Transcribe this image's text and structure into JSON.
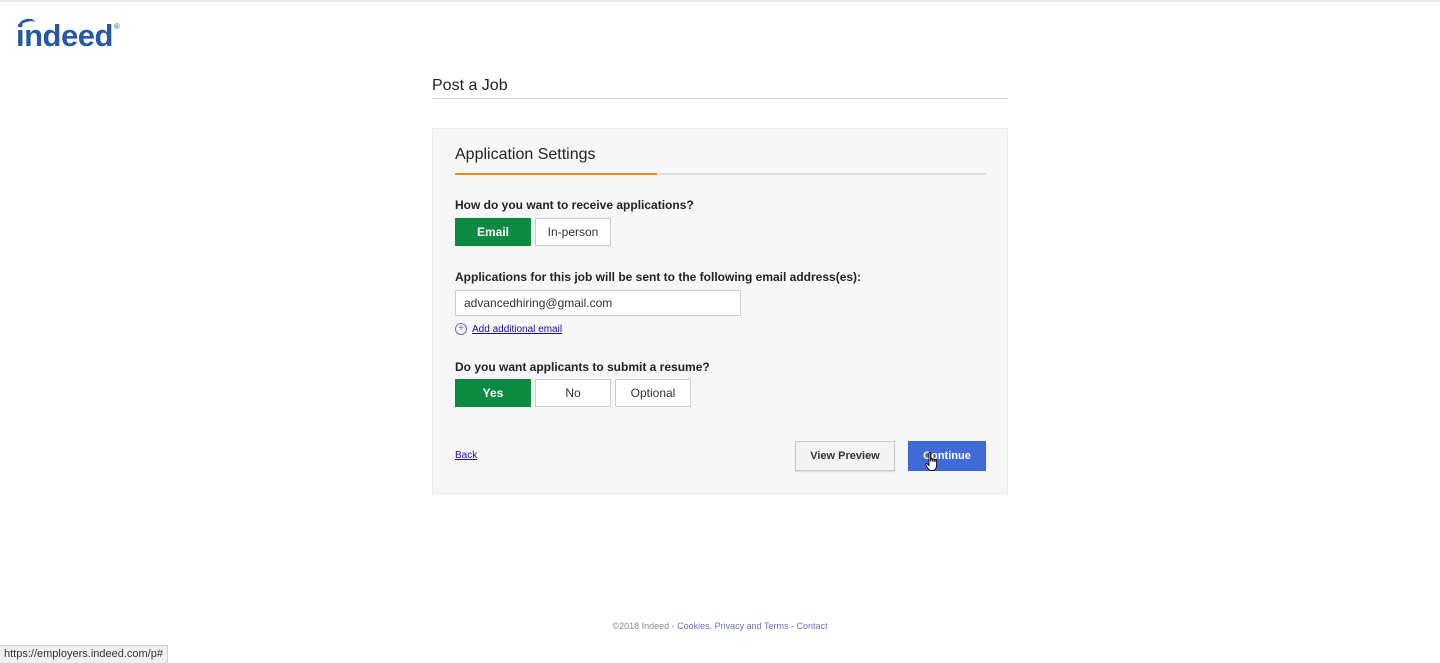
{
  "brand": {
    "logo_text": "indeed",
    "registered_mark": "®",
    "color": "#2557a7"
  },
  "page": {
    "title": "Post a Job"
  },
  "card": {
    "section_title": "Application Settings",
    "progress_fraction": 0.38,
    "receive": {
      "question": "How do you want to receive applications?",
      "options": [
        "Email",
        "In-person"
      ],
      "selected": "Email"
    },
    "email": {
      "label": "Applications for this job will be sent to the following email address(es):",
      "value": "advancedhiring@gmail.com",
      "add_link": "Add additional email"
    },
    "resume": {
      "question": "Do you want applicants to submit a resume?",
      "options": [
        "Yes",
        "No",
        "Optional"
      ],
      "selected": "Yes"
    },
    "actions": {
      "back": "Back",
      "preview": "View Preview",
      "continue": "Continue"
    }
  },
  "footer": {
    "copyright": "©2018 Indeed - ",
    "cookies_link": "Cookies, Privacy and Terms",
    "sep": " - ",
    "contact_link": "Contact"
  },
  "status_bar": {
    "url": "https://employers.indeed.com/p#"
  },
  "colors": {
    "selected_green": "#0a8b41",
    "continue_blue": "#3f6ad8",
    "progress_orange": "#f08c1c"
  }
}
